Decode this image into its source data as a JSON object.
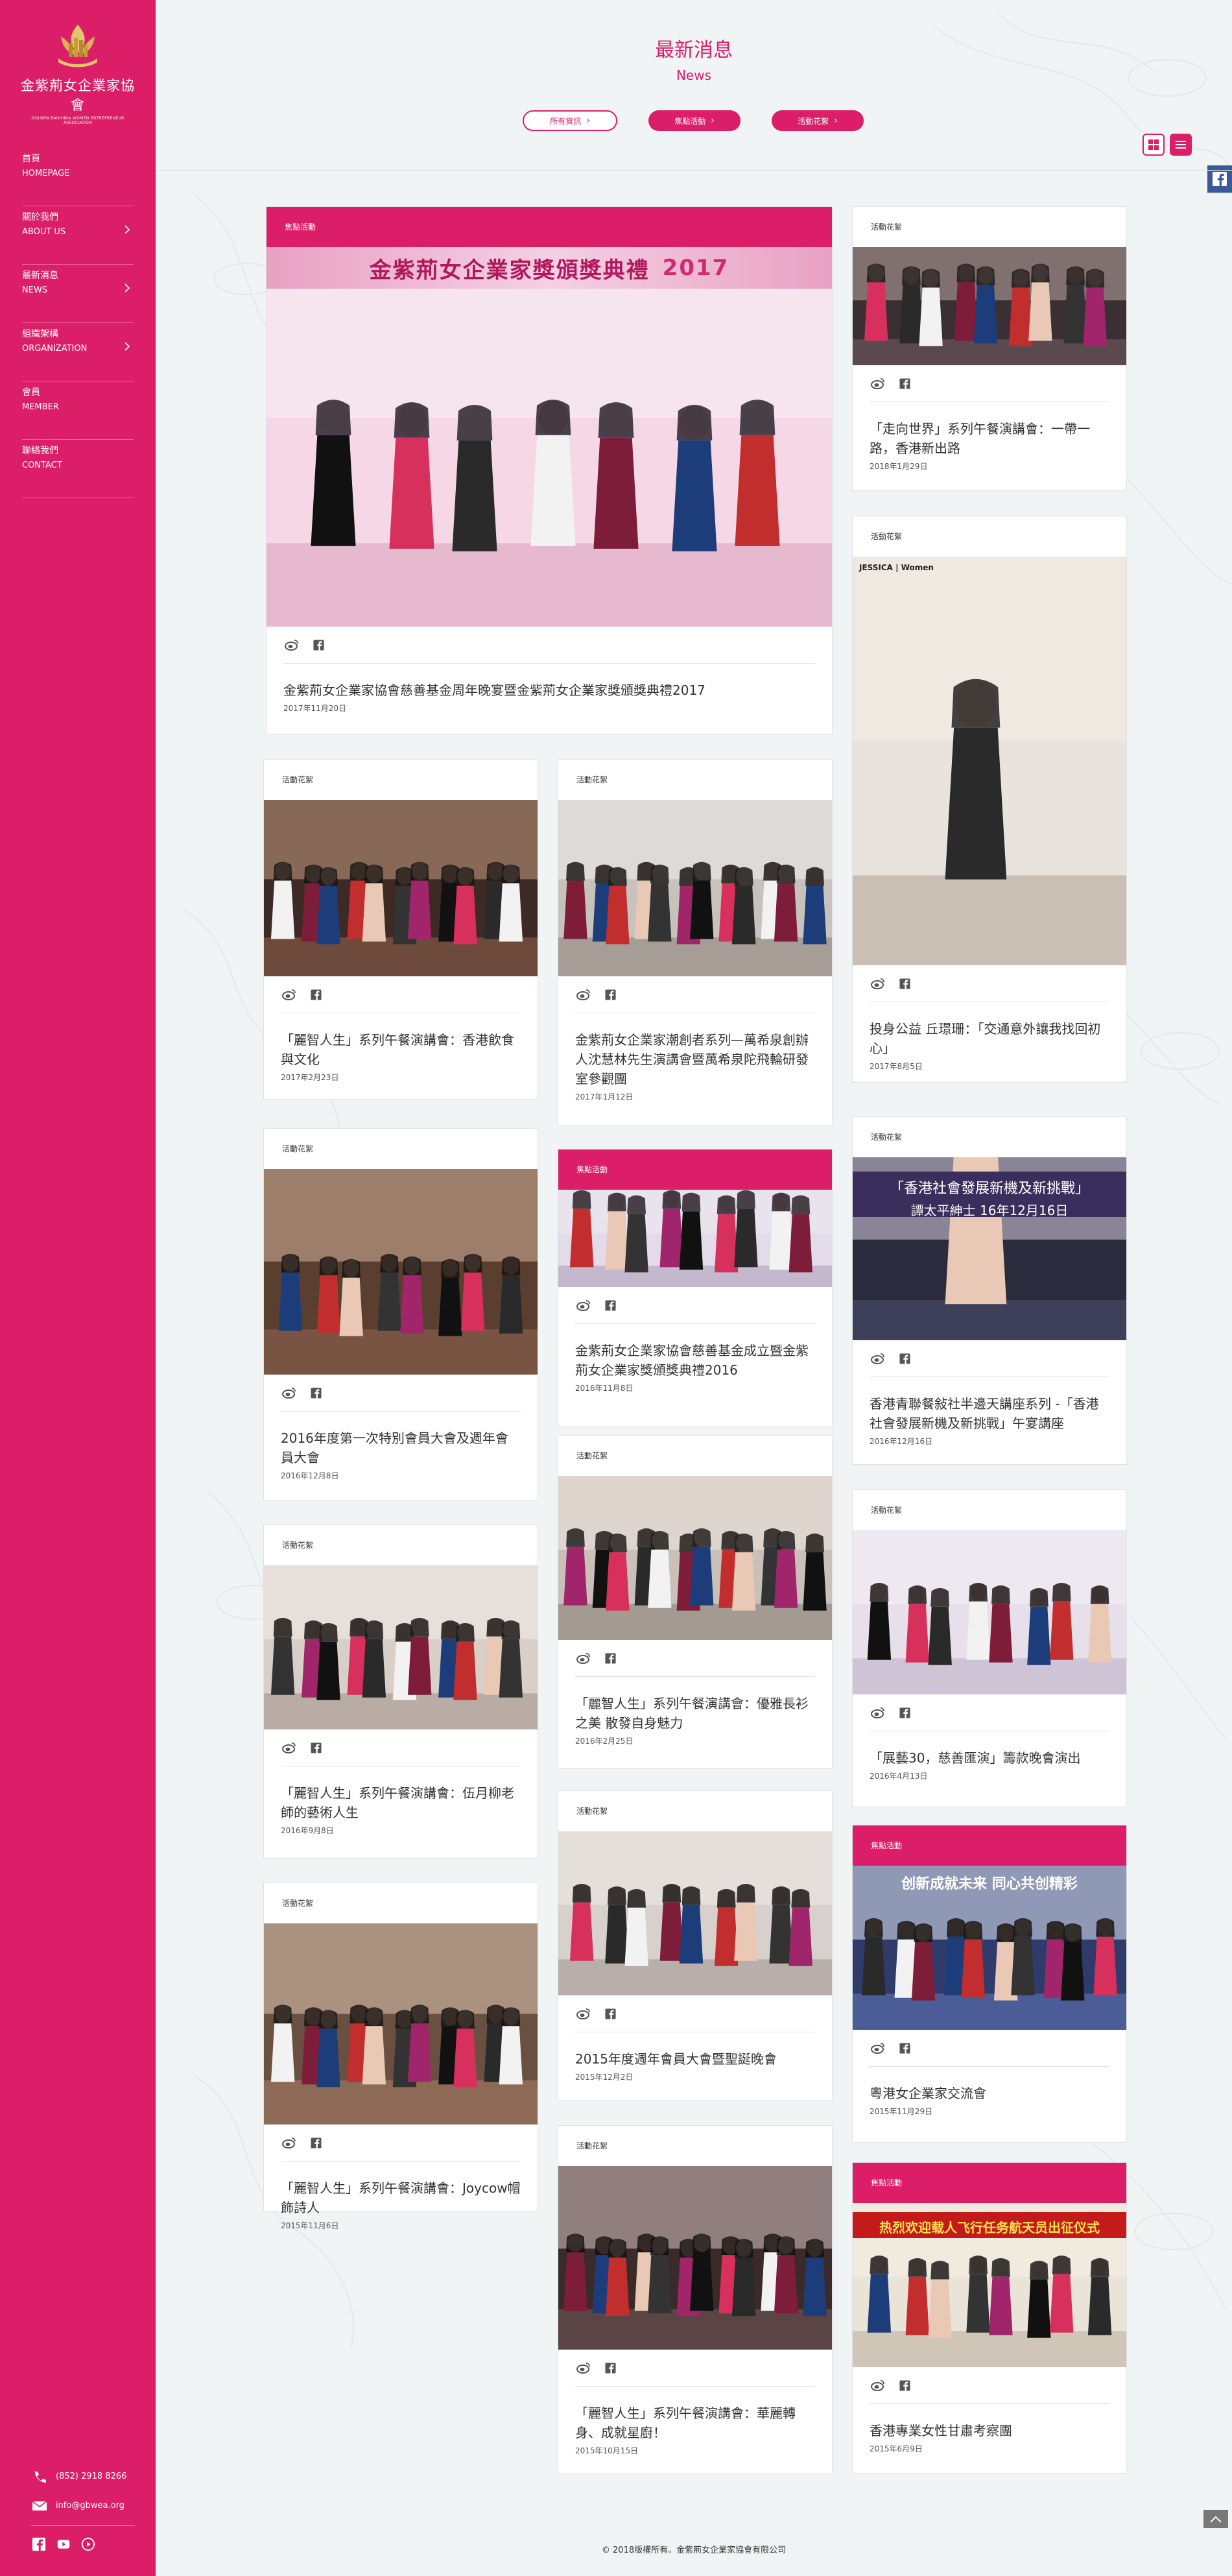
{
  "site": {
    "logo_name": "金紫荊女企業家協會",
    "logo_sub": "GOLDEN BAUHINIA WOMEN ENTREPRENEUR ASSOCIATION"
  },
  "nav": [
    {
      "zh": "首頁",
      "en": "HOMEPAGE",
      "has_sub": false
    },
    {
      "zh": "關於我們",
      "en": "ABOUT US",
      "has_sub": true
    },
    {
      "zh": "最新消息",
      "en": "NEWS",
      "has_sub": true
    },
    {
      "zh": "組織架構",
      "en": "ORGANIZATION",
      "has_sub": true
    },
    {
      "zh": "會員",
      "en": "MEMBER",
      "has_sub": false
    },
    {
      "zh": "聯絡我們",
      "en": "CONTACT",
      "has_sub": false
    }
  ],
  "contact": {
    "phone": "(852) 2918 8266",
    "email": "info@gbwea.org"
  },
  "header": {
    "title": "最新消息",
    "subtitle": "News"
  },
  "filters": [
    {
      "label": "所有資訊",
      "style": "outline"
    },
    {
      "label": "焦點活動",
      "style": "solid"
    },
    {
      "label": "活動花絮",
      "style": "solid"
    }
  ],
  "colors": {
    "accent": "#dc1d68",
    "facebook": "#3b5998"
  },
  "cards": [
    {
      "tag": "焦點活動",
      "tag_style": "pink",
      "title": "金紫荊女企業家協會慈善基金周年晚宴暨金紫荊女企業家獎頒獎典禮2017",
      "date": "2017年11月20日",
      "banner": "金紫荊女企業家獎頒獎典禮",
      "banner_year": "2017"
    },
    {
      "tag": "活動花絮",
      "tag_style": "plain",
      "title": "「走向世界」系列午餐演講會：一帶一路，香港新出路",
      "date": "2018年1月29日"
    },
    {
      "tag": "活動花絮",
      "tag_style": "plain",
      "title": "投身公益 丘璟珊：「交通意外讓我找回初心」",
      "date": "2017年8月5日",
      "photo_label": "JESSICA | Women"
    },
    {
      "tag": "活動花絮",
      "tag_style": "plain",
      "title": "「麗智人生」系列午餐演講會：香港飲食與文化",
      "date": "2017年2月23日"
    },
    {
      "tag": "活動花絮",
      "tag_style": "plain",
      "title": "金紫荊女企業家潮創者系列—萬希泉創辦人沈慧林先生演講會暨萬希泉陀飛輪研發室參觀團",
      "date": "2017年1月12日"
    },
    {
      "tag": "活動花絮",
      "tag_style": "plain",
      "title": "2016年度第一次特別會員大會及週年會員大會",
      "date": "2016年12月8日"
    },
    {
      "tag": "焦點活動",
      "tag_style": "pink",
      "title": "金紫荊女企業家協會慈善基金成立暨金紫荊女企業家獎頒獎典禮2016",
      "date": "2016年11月8日"
    },
    {
      "tag": "活動花絮",
      "tag_style": "plain",
      "title": "香港青聯餐敍社半邊天講座系列 -「香港社會發展新機及新挑戰」午宴講座",
      "date": "2016年12月16日",
      "banner": "「香港社會發展新機及新挑戰」",
      "banner2": "譚太平紳士",
      "banner_date": "16年12月16日"
    },
    {
      "tag": "活動花絮",
      "tag_style": "plain",
      "title": "「麗智人生」系列午餐演講會：伍月柳老師的藝術人生",
      "date": "2016年9月8日"
    },
    {
      "tag": "活動花絮",
      "tag_style": "plain",
      "title": "「麗智人生」系列午餐演講會：優雅長衫之美 散發自身魅力",
      "date": "2016年2月25日"
    },
    {
      "tag": "活動花絮",
      "tag_style": "plain",
      "title": "「展藝30，慈善匯演」籌款晚會演出",
      "date": "2016年4月13日"
    },
    {
      "tag": "活動花絮",
      "tag_style": "plain",
      "title": "2015年度週年會員大會暨聖誕晚會",
      "date": "2015年12月2日"
    },
    {
      "tag": "焦點活動",
      "tag_style": "pink",
      "title": "粵港女企業家交流會",
      "date": "2015年11月29日",
      "banner": "创新成就未来 同心共创精彩"
    },
    {
      "tag": "活動花絮",
      "tag_style": "plain",
      "title": "「麗智人生」系列午餐演講會：Joycow帽飾詩人",
      "date": "2015年11月6日"
    },
    {
      "tag": "活動花絮",
      "tag_style": "plain",
      "title": "「麗智人生」系列午餐演講會：華麗轉身、成就星廚！",
      "date": "2015年10月15日"
    },
    {
      "tag": "焦點活動",
      "tag_style": "pink",
      "title": "香港專業女性甘肅考察團",
      "date": "2015年6月9日",
      "banner": "热烈欢迎载人飞行任务航天员出征仪式"
    }
  ],
  "footer": {
    "copyright": "© 2018版權所有。金紫荊女企業家協會有限公司"
  }
}
